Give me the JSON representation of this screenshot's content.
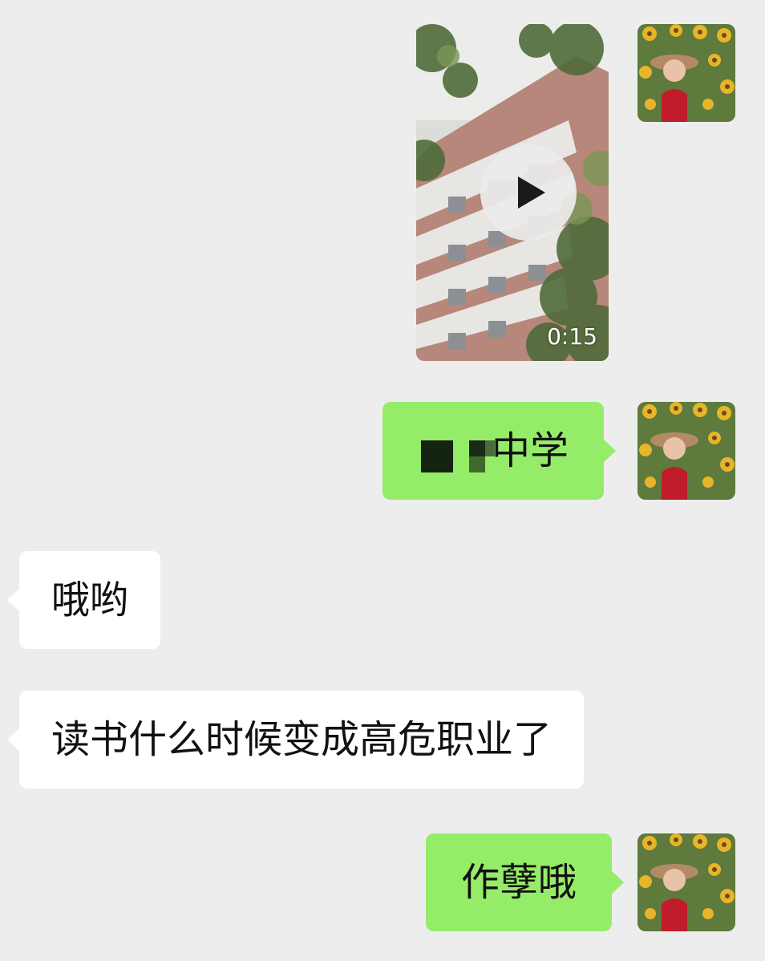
{
  "messages": [
    {
      "type": "video",
      "side": "right",
      "duration": "0:15"
    },
    {
      "type": "text",
      "side": "right",
      "text": "中学",
      "redacted_prefix": true
    },
    {
      "type": "text",
      "side": "left",
      "text": "哦哟"
    },
    {
      "type": "text",
      "side": "left",
      "text": "读书什么时候变成高危职业了"
    },
    {
      "type": "text",
      "side": "right",
      "text": "作孽哦"
    }
  ],
  "colors": {
    "background": "#ededed",
    "outgoing_bubble": "#95ec69",
    "incoming_bubble": "#ffffff"
  },
  "icons": {
    "play": "play-icon",
    "avatar": "sunflower-portrait"
  }
}
